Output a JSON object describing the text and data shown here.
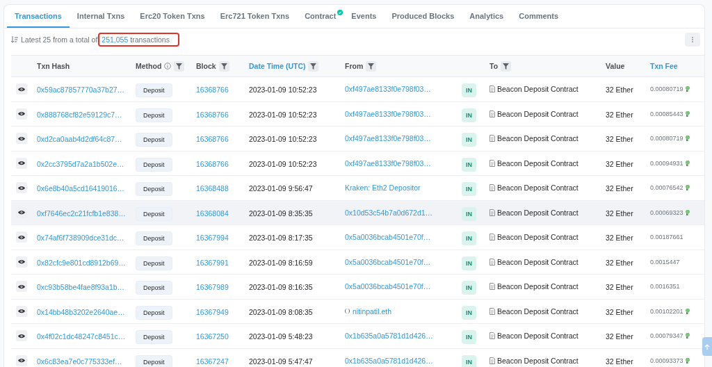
{
  "tabs": [
    {
      "label": "Transactions",
      "selected": true,
      "verified": false
    },
    {
      "label": "Internal Txns",
      "selected": false,
      "verified": false
    },
    {
      "label": "Erc20 Token Txns",
      "selected": false,
      "verified": false
    },
    {
      "label": "Erc721 Token Txns",
      "selected": false,
      "verified": false
    },
    {
      "label": "Contract",
      "selected": false,
      "verified": true
    },
    {
      "label": "Events",
      "selected": false,
      "verified": false
    },
    {
      "label": "Produced Blocks",
      "selected": false,
      "verified": false
    },
    {
      "label": "Analytics",
      "selected": false,
      "verified": false
    },
    {
      "label": "Comments",
      "selected": false,
      "verified": false
    }
  ],
  "summary": {
    "prefix": "Latest 25 from a total of",
    "count": "251,055",
    "suffix": "transactions",
    "annotated": true
  },
  "table": {
    "columns": [
      {
        "label": "Txn Hash",
        "active": false,
        "kind": "plain"
      },
      {
        "label": "Method",
        "active": false,
        "kind": "info_filter"
      },
      {
        "label": "Block",
        "active": false,
        "kind": "filter"
      },
      {
        "label": "Date Time (UTC)",
        "active": true,
        "kind": "filter"
      },
      {
        "label": "From",
        "active": false,
        "kind": "filter"
      },
      {
        "label": "To",
        "active": false,
        "kind": "filter"
      },
      {
        "label": "Value",
        "active": false,
        "kind": "plain"
      },
      {
        "label": "Txn Fee",
        "active": true,
        "kind": "plain"
      }
    ],
    "rows": [
      {
        "hash": "0x59ac87857770a37b27…",
        "method": "Deposit",
        "block": "16368766",
        "time": "2023-01-09 10:52:23",
        "from": "0xf497ae8133f0e798f03…",
        "ens": false,
        "direction": "IN",
        "to": "Beacon Deposit Contract",
        "value": "32 Ether",
        "fee": "0.00080719",
        "fee_icon": true,
        "hovered": false
      },
      {
        "hash": "0x888768cf82e59129c7…",
        "method": "Deposit",
        "block": "16368766",
        "time": "2023-01-09 10:52:23",
        "from": "0xf497ae8133f0e798f03…",
        "ens": false,
        "direction": "IN",
        "to": "Beacon Deposit Contract",
        "value": "32 Ether",
        "fee": "0.00085443",
        "fee_icon": true,
        "hovered": false
      },
      {
        "hash": "0xd2ca0aab4d2df64c87…",
        "method": "Deposit",
        "block": "16368766",
        "time": "2023-01-09 10:52:23",
        "from": "0xf497ae8133f0e798f03…",
        "ens": false,
        "direction": "IN",
        "to": "Beacon Deposit Contract",
        "value": "32 Ether",
        "fee": "0.00080719",
        "fee_icon": true,
        "hovered": false
      },
      {
        "hash": "0x2cc3795d7a2a1b502e…",
        "method": "Deposit",
        "block": "16368766",
        "time": "2023-01-09 10:52:23",
        "from": "0xf497ae8133f0e798f03…",
        "ens": false,
        "direction": "IN",
        "to": "Beacon Deposit Contract",
        "value": "32 Ether",
        "fee": "0.00094931",
        "fee_icon": true,
        "hovered": false
      },
      {
        "hash": "0x6e8b40a5cd16419016…",
        "method": "Deposit",
        "block": "16368488",
        "time": "2023-01-09 9:56:47",
        "from": "Kraken: Eth2 Depositor",
        "ens": false,
        "direction": "IN",
        "to": "Beacon Deposit Contract",
        "value": "32 Ether",
        "fee": "0.00076542",
        "fee_icon": true,
        "hovered": false
      },
      {
        "hash": "0xf7646ec2c21fcfb1e838…",
        "method": "Deposit",
        "block": "16368084",
        "time": "2023-01-09 8:35:35",
        "from": "0x10d53c54b7a0d672d1…",
        "ens": false,
        "direction": "IN",
        "to": "Beacon Deposit Contract",
        "value": "32 Ether",
        "fee": "0.00069323",
        "fee_icon": true,
        "hovered": true
      },
      {
        "hash": "0x74af6f738909dce31dc…",
        "method": "Deposit",
        "block": "16367994",
        "time": "2023-01-09 8:17:35",
        "from": "0x5a0036bcab4501e70f…",
        "ens": false,
        "direction": "IN",
        "to": "Beacon Deposit Contract",
        "value": "32 Ether",
        "fee": "0.00187661",
        "fee_icon": false,
        "hovered": false
      },
      {
        "hash": "0x82cfc9e801cd8912b69…",
        "method": "Deposit",
        "block": "16367991",
        "time": "2023-01-09 8:16:59",
        "from": "0x5a0036bcab4501e70f…",
        "ens": false,
        "direction": "IN",
        "to": "Beacon Deposit Contract",
        "value": "32 Ether",
        "fee": "0.0015447",
        "fee_icon": false,
        "hovered": false
      },
      {
        "hash": "0xc93b58be4fae8f93a1b…",
        "method": "Deposit",
        "block": "16367989",
        "time": "2023-01-09 8:16:35",
        "from": "0x5a0036bcab4501e70f…",
        "ens": false,
        "direction": "IN",
        "to": "Beacon Deposit Contract",
        "value": "32 Ether",
        "fee": "0.0016351",
        "fee_icon": false,
        "hovered": false
      },
      {
        "hash": "0x14bb48b3202e2640ae…",
        "method": "Deposit",
        "block": "16367949",
        "time": "2023-01-09 8:08:35",
        "from": "nitinpatil.eth",
        "ens": true,
        "direction": "IN",
        "to": "Beacon Deposit Contract",
        "value": "32 Ether",
        "fee": "0.00102201",
        "fee_icon": true,
        "hovered": false
      },
      {
        "hash": "0x4f02c1dc48247c8451c…",
        "method": "Deposit",
        "block": "16367250",
        "time": "2023-01-09 5:48:23",
        "from": "0x1b635a0a5781d1d426…",
        "ens": false,
        "direction": "IN",
        "to": "Beacon Deposit Contract",
        "value": "32 Ether",
        "fee": "0.00079347",
        "fee_icon": true,
        "hovered": false
      },
      {
        "hash": "0x6c83ea7e0c775333ef…",
        "method": "Deposit",
        "block": "16367247",
        "time": "2023-01-09 5:47:47",
        "from": "0x1b635a0a5781d1d426…",
        "ens": false,
        "direction": "IN",
        "to": "Beacon Deposit Contract",
        "value": "32 Ether",
        "fee": "0.00093373",
        "fee_icon": true,
        "hovered": false
      }
    ]
  }
}
